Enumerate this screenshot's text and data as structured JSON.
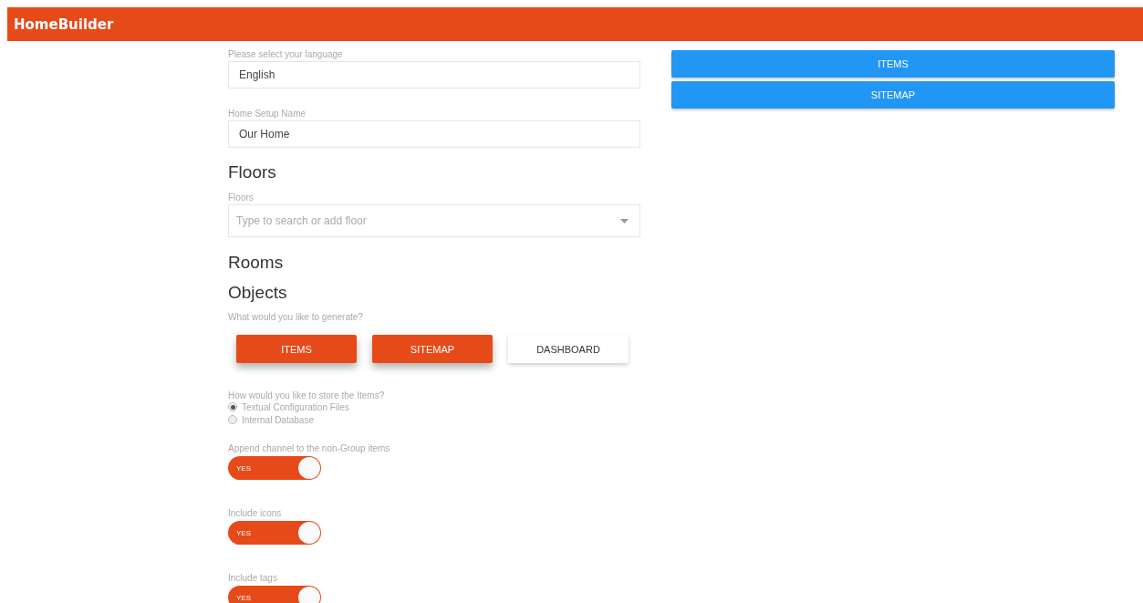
{
  "header": {
    "title": "HomeBuilder"
  },
  "language": {
    "label": "Please select your language",
    "value": "English"
  },
  "setup_name": {
    "label": "Home Setup Name",
    "value": "Our Home"
  },
  "floors": {
    "heading": "Floors",
    "label": "Floors",
    "placeholder": "Type to search or add floor"
  },
  "rooms": {
    "heading": "Rooms"
  },
  "objects": {
    "heading": "Objects"
  },
  "generate": {
    "question": "What would you like to generate?",
    "options": [
      {
        "label": "ITEMS",
        "selected": true
      },
      {
        "label": "SITEMAP",
        "selected": true
      },
      {
        "label": "DASHBOARD",
        "selected": false
      }
    ]
  },
  "storage": {
    "question": "How would you like to store the Items?",
    "options": [
      {
        "label": "Textual Configuration Files",
        "selected": true
      },
      {
        "label": "Internal Database",
        "selected": false
      }
    ]
  },
  "toggles": [
    {
      "label": "Append channel to the non-Group items",
      "text": "YES",
      "on": true
    },
    {
      "label": "Include icons",
      "text": "YES",
      "on": true
    },
    {
      "label": "Include tags",
      "text": "YES",
      "on": true
    }
  ],
  "output_tabs": [
    {
      "label": "ITEMS"
    },
    {
      "label": "SITEMAP"
    }
  ]
}
